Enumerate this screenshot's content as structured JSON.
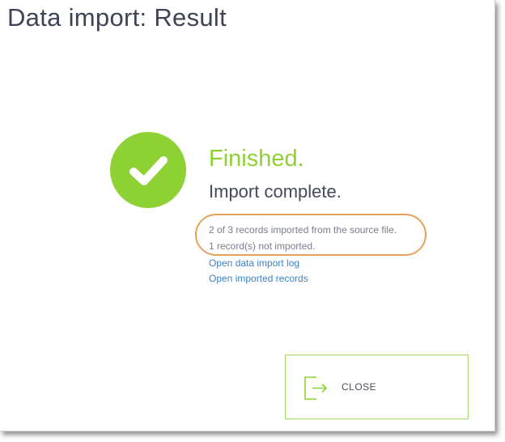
{
  "dialog": {
    "title": "Data import: Result"
  },
  "result": {
    "icon": "check-circle-icon",
    "heading": "Finished.",
    "subheading": "Import complete.",
    "summary_line_1": "2 of 3 records imported from the source file.",
    "summary_line_2": "1 record(s) not imported."
  },
  "links": {
    "open_log": "Open data import log",
    "open_records": "Open imported records"
  },
  "close_button": {
    "label": "CLOSE",
    "icon": "exit-icon"
  },
  "colors": {
    "accent_green": "#8ed135",
    "highlight_orange": "#e8a15a",
    "link_blue": "#3e82c4",
    "title_text": "#3f4356"
  }
}
